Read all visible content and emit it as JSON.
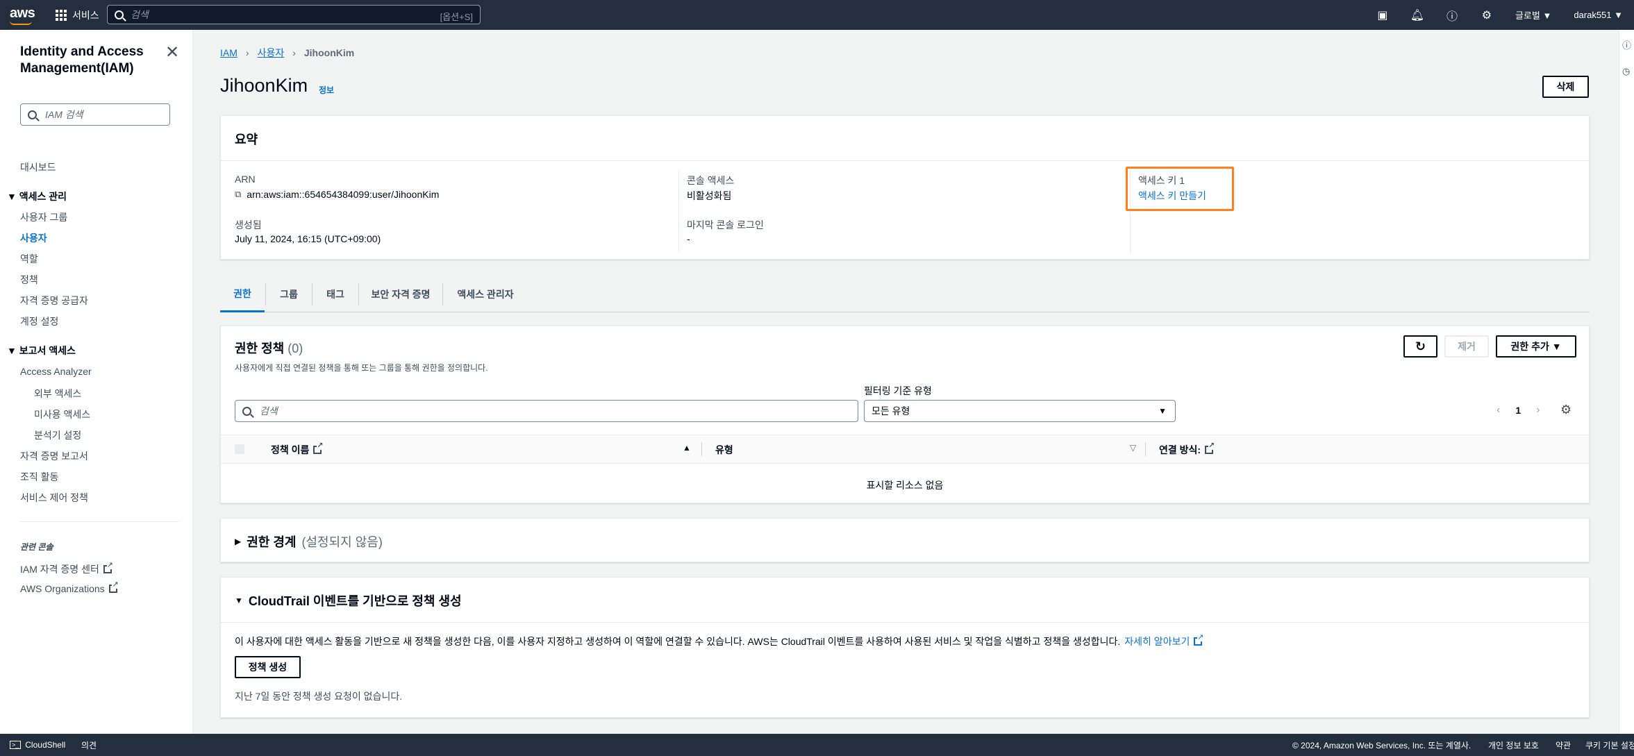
{
  "topnav": {
    "logo": "aws",
    "services_label": "서비스",
    "search_placeholder": "검색",
    "search_shortcut": "[옵션+S]",
    "region": "글로벌 ▼",
    "account": "darak551 ▼",
    "icons": [
      "cloudshell-icon",
      "bell-icon",
      "help-icon",
      "gear-icon"
    ]
  },
  "sidebar": {
    "title": "Identity and Access Management(IAM)",
    "search_placeholder": "IAM 검색",
    "dashboard": "대시보드",
    "access_mgmt": "액세스 관리",
    "access_items": [
      "사용자 그룹",
      "사용자",
      "역할",
      "정책",
      "자격 증명 공급자",
      "계정 설정"
    ],
    "reports": "보고서 액세스",
    "report_items": [
      "Access Analyzer",
      "외부 액세스",
      "미사용 액세스",
      "분석기 설정",
      "자격 증명 보고서",
      "조직 활동",
      "서비스 제어 정책"
    ],
    "related_title": "관련 콘솔",
    "related_items": [
      "IAM 자격 증명 센터",
      "AWS Organizations"
    ]
  },
  "breadcrumb": [
    "IAM",
    "사용자",
    "JihoonKim"
  ],
  "page": {
    "title": "JihoonKim",
    "info": "정보",
    "delete_btn": "삭제"
  },
  "summary": {
    "header": "요약",
    "arn_label": "ARN",
    "arn_value": "arn:aws:iam::654654384099:user/JihoonKim",
    "created_label": "생성됨",
    "created_value": "July 11, 2024, 16:15 (UTC+09:00)",
    "console_label": "콘솔 액세스",
    "console_value": "비활성화됨",
    "last_login_label": "마지막 콘솔 로그인",
    "last_login_value": "-",
    "access_key_label": "액세스 키 1",
    "access_key_link": "액세스 키 만들기"
  },
  "tabs": [
    "권한",
    "그룹",
    "태그",
    "보안 자격 증명",
    "액세스 관리자"
  ],
  "permissions": {
    "title": "권한 정책",
    "count": "(0)",
    "description": "사용자에게 직접 연결된 정책을 통해 또는 그룹을 통해 권한을 정의합니다.",
    "remove_btn": "제거",
    "add_btn": "권한 추가 ▼",
    "search_placeholder": "검색",
    "filter_label": "필터링 기준 유형",
    "filter_value": "모든 유형",
    "page": "1",
    "columns": [
      "정책 이름",
      "유형",
      "연결 방식:"
    ],
    "empty": "표시할 리소스 없음"
  },
  "boundary": {
    "title": "권한 경계",
    "subtitle": "(설정되지 않음)"
  },
  "cloudtrail": {
    "title": "CloudTrail 이벤트를 기반으로 정책 생성",
    "description": "이 사용자에 대한 액세스 활동을 기반으로 새 정책을 생성한 다음, 이를 사용자 지정하고 생성하여 이 역할에 연결할 수 있습니다. AWS는 CloudTrail 이벤트를 사용하여 사용된 서비스 및 작업을 식별하고 정책을 생성합니다.",
    "learn_more": "자세히 알아보기",
    "generate_btn": "정책 생성",
    "note": "지난 7일 동안 정책 생성 요청이 없습니다."
  },
  "footer": {
    "cloudshell": "CloudShell",
    "feedback": "의견",
    "copyright": "© 2024, Amazon Web Services, Inc. 또는 계열사.",
    "privacy": "개인 정보 보호",
    "terms": "약관",
    "cookies": "쿠키 기본 설정"
  },
  "colors": {
    "nav_bg": "#232f3e",
    "link": "#0972d3",
    "highlight": "#ff7f1a"
  }
}
